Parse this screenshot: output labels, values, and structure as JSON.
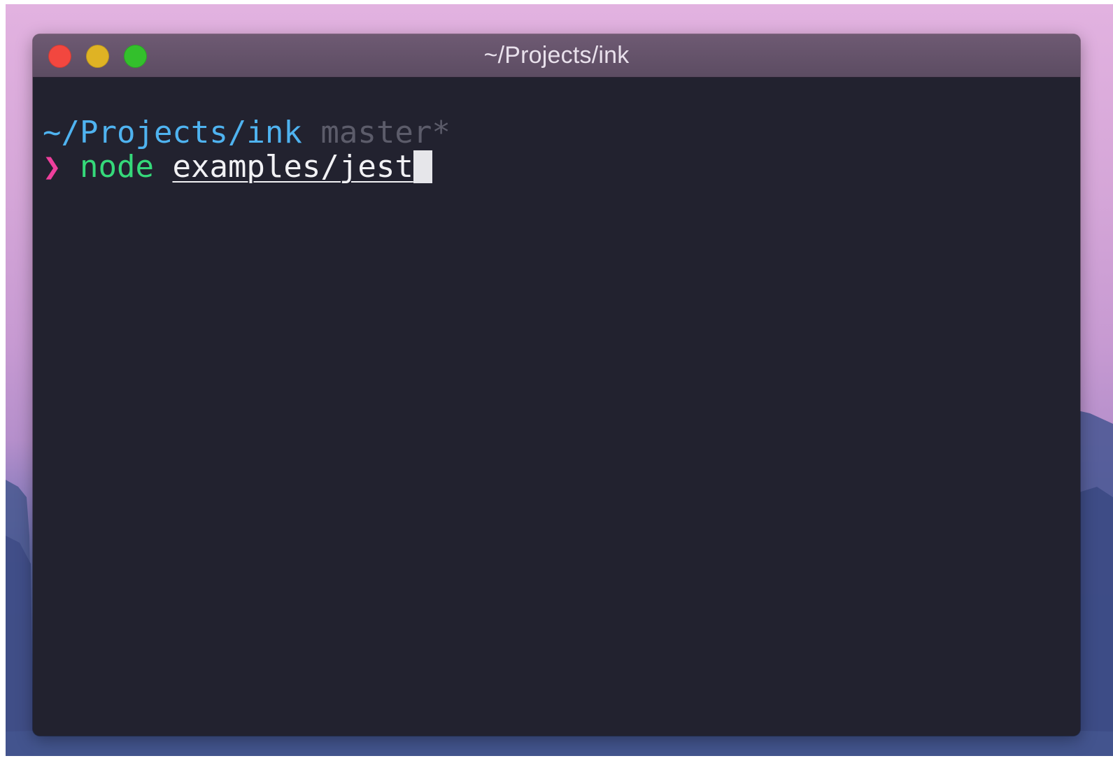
{
  "window": {
    "title": "~/Projects/ink",
    "controls": {
      "close_color": "#f2473f",
      "minimize_color": "#dfb324",
      "maximize_color": "#33c02c"
    }
  },
  "terminal": {
    "prompt_line": {
      "cwd": "~/Projects/ink",
      "branch": "master*"
    },
    "command_line": {
      "prompt_symbol": "❯",
      "command": "node",
      "argument": "examples/jest"
    },
    "colors": {
      "background": "#22222f",
      "cwd": "#4fb3f0",
      "branch": "#5c5c6a",
      "prompt_symbol": "#ee3f9c",
      "command": "#35d97a",
      "argument": "#f1f1f4"
    }
  }
}
